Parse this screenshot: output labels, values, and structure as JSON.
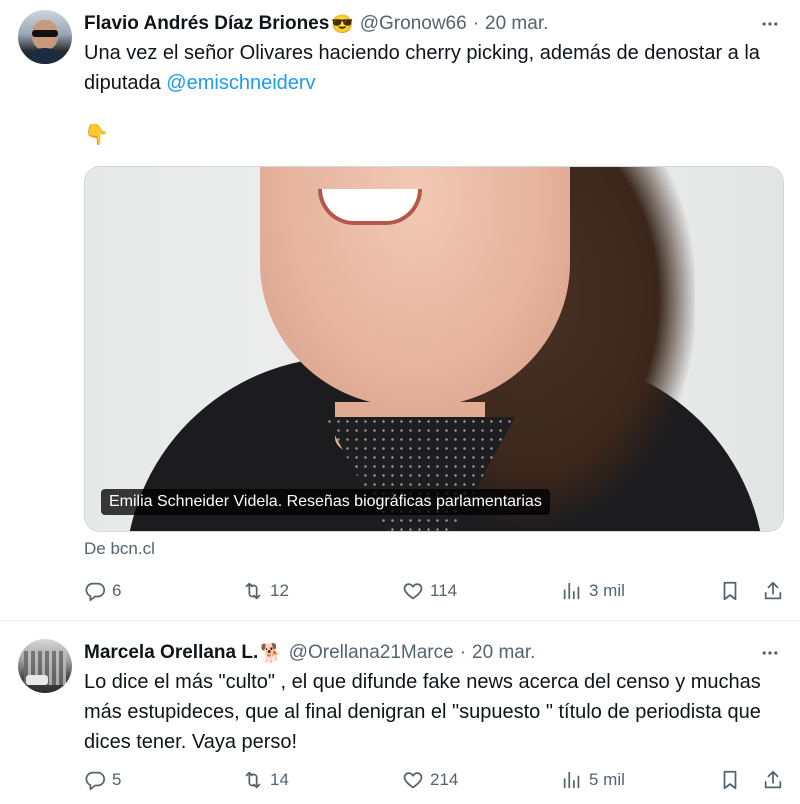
{
  "tweets": [
    {
      "author_name": "Flavio Andrés Díaz Briones",
      "author_emoji": "😎",
      "handle": "@Gronow66",
      "separator": "·",
      "date": "20 mar.",
      "text_before_mention": "Una vez el señor Olivares haciendo cherry picking, además de denostar a la diputada ",
      "mention": "@emischneiderv",
      "pointing_emoji": "👇",
      "media_caption": "Emilia Schneider Videla. Reseñas biográficas parlamentarias",
      "source_label": "De bcn.cl",
      "replies": "6",
      "retweets": "12",
      "likes": "114",
      "views": "3 mil"
    },
    {
      "author_name": "Marcela Orellana L.",
      "author_emoji": "🐕",
      "handle": "@Orellana21Marce",
      "separator": "·",
      "date": "20 mar.",
      "text": "Lo dice el más \"culto\" , el que difunde fake news acerca del censo y muchas más estupideces, que al final denigran el \"supuesto \" título de periodista que dices tener. Vaya  perso!",
      "replies": "5",
      "retweets": "14",
      "likes": "214",
      "views": "5 mil"
    }
  ],
  "colors": {
    "text": "#0f1419",
    "secondary": "#536471",
    "link": "#1d9bf0",
    "divider": "#eff3f4"
  },
  "icons": [
    "more-icon",
    "reply-icon",
    "retweet-icon",
    "like-icon",
    "views-icon",
    "bookmark-icon",
    "share-icon"
  ]
}
